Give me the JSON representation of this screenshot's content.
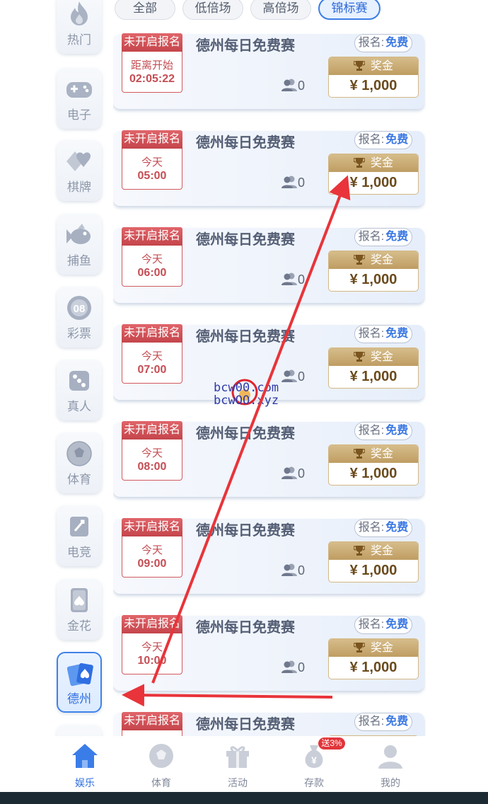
{
  "sidebar": {
    "items": [
      {
        "label": "热门",
        "icon": "flame-icon"
      },
      {
        "label": "电子",
        "icon": "gamepad-icon"
      },
      {
        "label": "棋牌",
        "icon": "cards-suit-icon"
      },
      {
        "label": "捕鱼",
        "icon": "fish-icon"
      },
      {
        "label": "彩票",
        "icon": "lottery-ball-icon",
        "ball_text": "08"
      },
      {
        "label": "真人",
        "icon": "dice-icon"
      },
      {
        "label": "体育",
        "icon": "soccer-ball-icon"
      },
      {
        "label": "电竞",
        "icon": "esports-icon"
      },
      {
        "label": "金花",
        "icon": "poker-card-icon"
      },
      {
        "label": "德州",
        "icon": "poker-cards-icon",
        "active": true
      }
    ]
  },
  "tabs": [
    {
      "label": "全部"
    },
    {
      "label": "低倍场"
    },
    {
      "label": "高倍场"
    },
    {
      "label": "锦标赛",
      "active": true
    }
  ],
  "tournaments": [
    {
      "status": "未开启报名",
      "time_line1": "距离开始",
      "time_line2": "02:05:22",
      "title": "德州每日免费赛",
      "reg_label": "报名:",
      "reg_value": "免费",
      "players": "0",
      "prize_label": "奖金",
      "prize_amount": "¥ 1,000"
    },
    {
      "status": "未开启报名",
      "time_line1": "今天",
      "time_line2": "05:00",
      "title": "德州每日免费赛",
      "reg_label": "报名:",
      "reg_value": "免费",
      "players": "0",
      "prize_label": "奖金",
      "prize_amount": "¥ 1,000"
    },
    {
      "status": "未开启报名",
      "time_line1": "今天",
      "time_line2": "06:00",
      "title": "德州每日免费赛",
      "reg_label": "报名:",
      "reg_value": "免费",
      "players": "0",
      "prize_label": "奖金",
      "prize_amount": "¥ 1,000"
    },
    {
      "status": "未开启报名",
      "time_line1": "今天",
      "time_line2": "07:00",
      "title": "德州每日免费赛",
      "reg_label": "报名:",
      "reg_value": "免费",
      "players": "0",
      "prize_label": "奖金",
      "prize_amount": "¥ 1,000"
    },
    {
      "status": "未开启报名",
      "time_line1": "今天",
      "time_line2": "08:00",
      "title": "德州每日免费赛",
      "reg_label": "报名:",
      "reg_value": "免费",
      "players": "0",
      "prize_label": "奖金",
      "prize_amount": "¥ 1,000"
    },
    {
      "status": "未开启报名",
      "time_line1": "今天",
      "time_line2": "09:00",
      "title": "德州每日免费赛",
      "reg_label": "报名:",
      "reg_value": "免费",
      "players": "0",
      "prize_label": "奖金",
      "prize_amount": "¥ 1,000"
    },
    {
      "status": "未开启报名",
      "time_line1": "今天",
      "time_line2": "10:00",
      "title": "德州每日免费赛",
      "reg_label": "报名:",
      "reg_value": "免费",
      "players": "0",
      "prize_label": "奖金",
      "prize_amount": "¥ 1,000"
    },
    {
      "status": "未开启报名",
      "time_line1": "",
      "time_line2": "",
      "title": "德州每日免费赛",
      "reg_label": "报名:",
      "reg_value": "免费",
      "players": "",
      "prize_label": "",
      "prize_amount": ""
    }
  ],
  "bottom_nav": [
    {
      "label": "娱乐",
      "icon": "home-icon",
      "active": true
    },
    {
      "label": "体育",
      "icon": "soccer-ball-icon"
    },
    {
      "label": "活动",
      "icon": "gift-icon"
    },
    {
      "label": "存款",
      "icon": "money-bag-icon",
      "badge": "送3%"
    },
    {
      "label": "我的",
      "icon": "user-icon"
    }
  ],
  "watermark": {
    "line1": "bcw00.com",
    "line2": "bcwOO.xyz"
  },
  "colors": {
    "accent": "#3c7de6",
    "status_red": "#c4454b",
    "gold": "#bf9d62",
    "free_blue": "#3b78e3"
  }
}
